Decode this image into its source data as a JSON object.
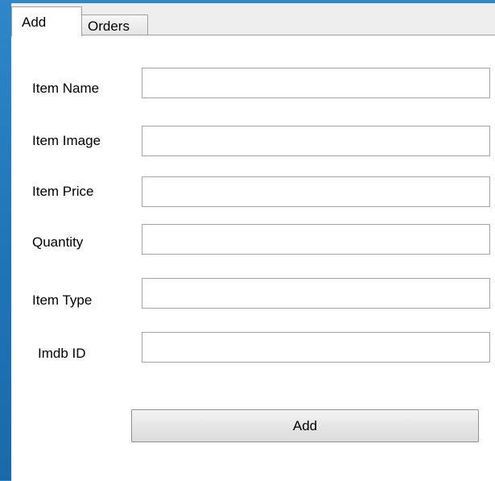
{
  "tabs": [
    {
      "label": "Add",
      "selected": true
    },
    {
      "label": "Orders",
      "selected": false
    }
  ],
  "form": {
    "fields": [
      {
        "label": "Item Name",
        "value": ""
      },
      {
        "label": "Item Image",
        "value": ""
      },
      {
        "label": "Item Price",
        "value": ""
      },
      {
        "label": "Quantity",
        "value": ""
      },
      {
        "label": "Item Type",
        "value": ""
      },
      {
        "label": "Imdb ID",
        "value": ""
      }
    ],
    "submit_label": "Add"
  },
  "colors": {
    "background": "#1f74b8",
    "panel": "#ffffff",
    "border": "#a5a5a5"
  }
}
